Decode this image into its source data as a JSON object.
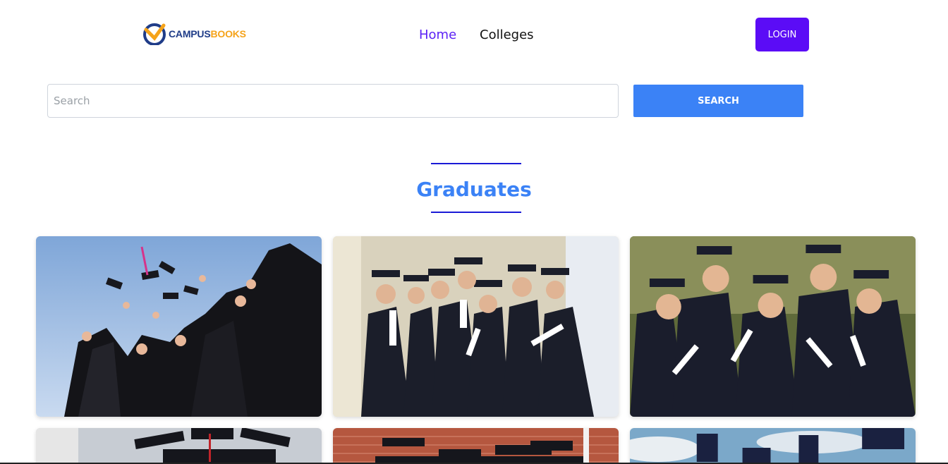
{
  "brand": {
    "name_part1": "CAMPUS",
    "name_part2": "BOOKS",
    "primary_color": "#1f3c88",
    "secondary_color": "#f5a31a"
  },
  "nav": {
    "items": [
      {
        "label": "Home",
        "active": true
      },
      {
        "label": "Colleges",
        "active": false
      }
    ],
    "login_label": "LOGIN"
  },
  "search": {
    "placeholder": "Search",
    "value": "",
    "button_label": "SEARCH"
  },
  "section": {
    "title": "Graduates"
  },
  "gallery": {
    "images": [
      {
        "icon": "graduates-throwing-caps-image"
      },
      {
        "icon": "graduates-group-diplomas-image"
      },
      {
        "icon": "graduates-smiling-diplomas-image"
      },
      {
        "icon": "graduates-row-image"
      },
      {
        "icon": "graduates-campus-image"
      },
      {
        "icon": "graduates-sky-image"
      }
    ]
  },
  "colors": {
    "accent": "#5b0cf6",
    "search_button": "#3b82f6",
    "title": "#3b82f6",
    "divider": "#1b1bd6"
  }
}
